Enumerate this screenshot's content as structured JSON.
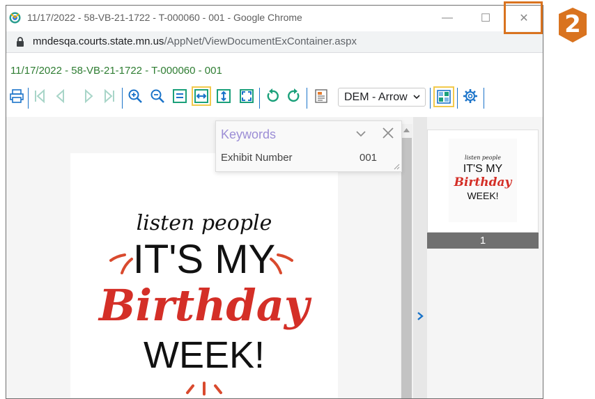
{
  "window": {
    "title": "11/17/2022 - 58-VB-21-1722 - T-000060 - 001 - Google Chrome",
    "minimize_glyph": "—",
    "maximize_glyph": "☐",
    "close_glyph": "✕"
  },
  "address_bar": {
    "host": "mndesqa.courts.state.mn.us",
    "path": "/AppNet/ViewDocumentExContainer.aspx"
  },
  "document": {
    "title": "11/17/2022 - 58-VB-21-1722 - T-000060 - 001"
  },
  "toolbar": {
    "annotation_select": "DEM - Arrow",
    "icons": [
      "print-icon",
      "first-page-icon",
      "previous-page-icon",
      "next-page-icon",
      "last-page-icon",
      "zoom-in-icon",
      "zoom-out-icon",
      "fit-window-icon",
      "fit-width-icon",
      "fit-height-icon",
      "full-page-icon",
      "rotate-left-icon",
      "rotate-right-icon",
      "document-properties-icon",
      "thumbnails-icon",
      "settings-icon"
    ]
  },
  "keywords_panel": {
    "title": "Keywords",
    "field_label": "Exhibit Number",
    "field_value": "001"
  },
  "page_image": {
    "line1": "listen people",
    "line2": "IT'S MY",
    "line3": "Birthday",
    "line4": "WEEK!"
  },
  "thumbnails": {
    "page_label": "1"
  },
  "tutorial": {
    "step_number": "2",
    "accent_color": "#d9731f"
  }
}
